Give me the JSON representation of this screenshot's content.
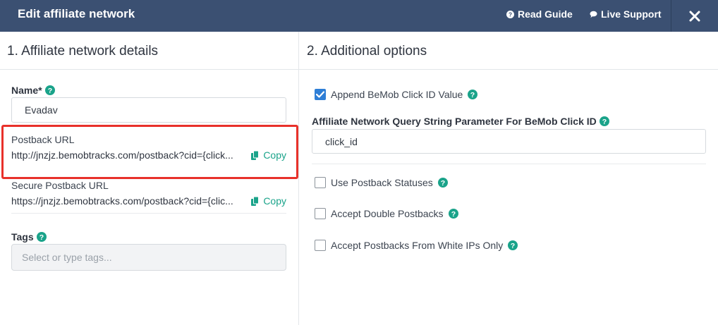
{
  "header": {
    "title": "Edit affiliate network",
    "read_guide": "Read Guide",
    "live_support": "Live Support"
  },
  "left": {
    "section_title": "1. Affiliate network details",
    "name_label": "Name*",
    "name_value": "Evadav",
    "postback_label": "Postback URL",
    "postback_url": "http://jnzjz.bemobtracks.com/postback?cid={click...",
    "copy_label": "Copy",
    "secure_label": "Secure Postback URL",
    "secure_url": "https://jnzjz.bemobtracks.com/postback?cid={clic...",
    "secure_copy_label": "Copy",
    "tags_label": "Tags",
    "tags_placeholder": "Select or type tags..."
  },
  "right": {
    "section_title": "2. Additional options",
    "append_label": "Append BeMob Click ID Value",
    "append_checked": true,
    "param_label": "Affiliate Network Query String Parameter For BeMob Click ID",
    "param_value": "click_id",
    "use_statuses_label": "Use Postback Statuses",
    "double_label": "Accept Double Postbacks",
    "white_ips_label": "Accept Postbacks From White IPs Only"
  },
  "colors": {
    "header_bg": "#3b5072",
    "accent_green": "#1aa38a",
    "help_green": "#1aa38a",
    "highlight_red": "#e8312a",
    "checkbox_blue": "#2e7ed6"
  }
}
